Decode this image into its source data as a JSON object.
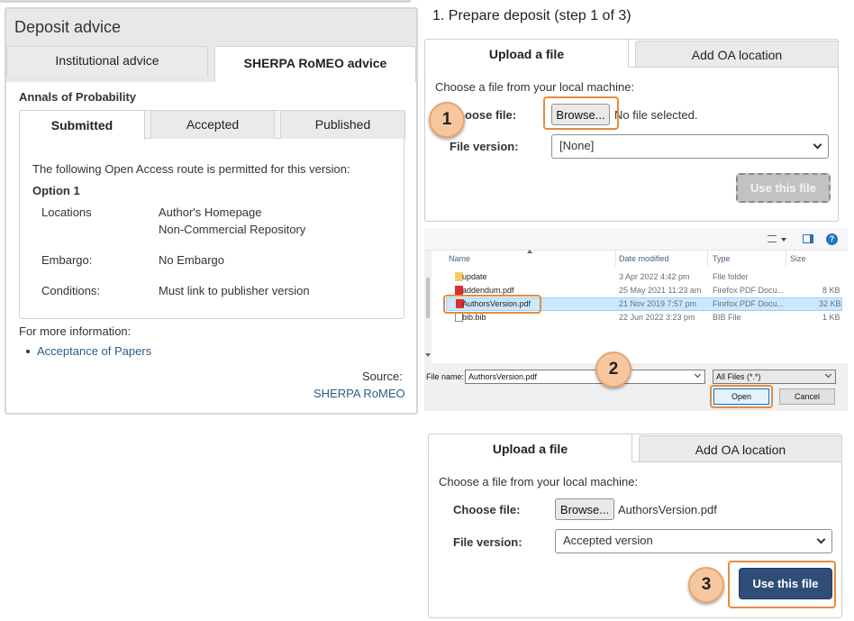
{
  "left": {
    "panel_title": "Deposit advice",
    "tabs": [
      "Institutional advice",
      "SHERPA RoMEO advice"
    ],
    "journal": "Annals of Probability",
    "version_tabs": [
      "Submitted",
      "Accepted",
      "Published"
    ],
    "intro": "The following Open Access route is permitted for this version:",
    "option": "Option 1",
    "locations_label": "Locations",
    "locations": [
      "Author's Homepage",
      "Non-Commercial Repository"
    ],
    "embargo_label": "Embargo:",
    "embargo": "No Embargo",
    "conditions_label": "Conditions:",
    "conditions": "Must link to publisher version",
    "more_info": "For more information:",
    "more_link": "Acceptance of Papers",
    "source_label": "Source:",
    "source_link": "SHERPA RoMEO"
  },
  "step1": {
    "title": "1. Prepare deposit (step 1 of 3)",
    "tabs": [
      "Upload a file",
      "Add OA location"
    ],
    "choose_prompt": "Choose a file from your local machine:",
    "choose_label": "Choose file:",
    "choose_label_visible": "oose file:",
    "browse": "Browse...",
    "no_file": "No file selected.",
    "version_label": "File version:",
    "version_value": "[None]",
    "use_button": "Use this file"
  },
  "dialog": {
    "columns": [
      "Name",
      "Date modified",
      "Type",
      "Size"
    ],
    "rows": [
      {
        "name": "update",
        "date": "3 Apr 2022 4:42 pm",
        "type": "File folder",
        "size": "",
        "icon": "folder"
      },
      {
        "name": "addendum.pdf",
        "date": "25 May 2021 11:23 am",
        "type": "Firefox PDF Docu...",
        "size": "8 KB",
        "icon": "pdf"
      },
      {
        "name": "AuthorsVersion.pdf",
        "date": "21 Nov 2019 7:57 pm",
        "type": "Firefox PDF Docu...",
        "size": "32 KB",
        "icon": "pdf"
      },
      {
        "name": "bib.bib",
        "date": "22 Jun 2022 3:23 pm",
        "type": "BIB File",
        "size": "1 KB",
        "icon": "file"
      }
    ],
    "filename_label": "File name:",
    "filename_value": "AuthorsVersion.pdf",
    "filter": "All Files (*.*)",
    "open": "Open",
    "cancel": "Cancel"
  },
  "step3": {
    "tabs": [
      "Upload a file",
      "Add OA location"
    ],
    "choose_prompt": "Choose a file from your local machine:",
    "choose_label": "Choose file:",
    "browse": "Browse...",
    "file_chosen": "AuthorsVersion.pdf",
    "version_label": "File version:",
    "version_value": "Accepted version",
    "use_button": "Use this file"
  },
  "badges": [
    "1",
    "2",
    "3"
  ],
  "colors": {
    "accent": "#2e4e78",
    "highlight": "#e88b3c",
    "badge": "#f6c79f",
    "link": "#2e5b8a"
  }
}
